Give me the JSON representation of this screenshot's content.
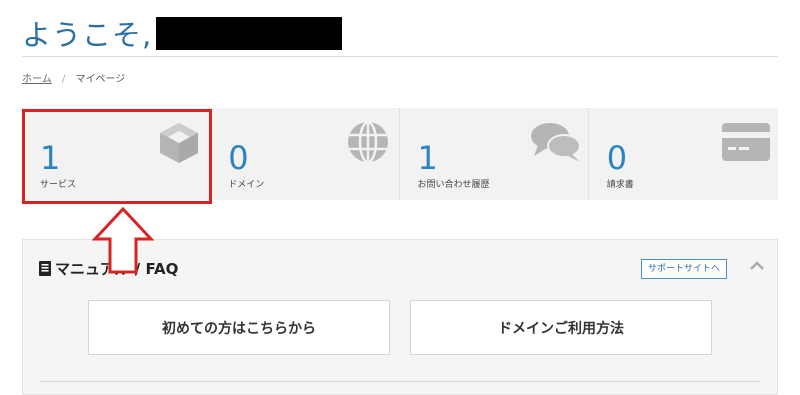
{
  "header": {
    "welcome": "ようこそ,"
  },
  "breadcrumb": {
    "home": "ホーム",
    "separator": "/",
    "current": "マイページ"
  },
  "stats": [
    {
      "value": "1",
      "label": "サービス",
      "icon": "cube-icon"
    },
    {
      "value": "0",
      "label": "ドメイン",
      "icon": "globe-icon"
    },
    {
      "value": "1",
      "label": "お問い合わせ履歴",
      "icon": "chat-bubbles-icon"
    },
    {
      "value": "0",
      "label": "請求書",
      "icon": "credit-card-icon"
    }
  ],
  "manual": {
    "title": "マニュアル / FAQ",
    "support_link": "サポートサイトへ",
    "buttons": [
      "初めての方はこちらから",
      "ドメインご利用方法"
    ]
  },
  "colors": {
    "accent": "#2b83c1",
    "highlight": "#d62424"
  }
}
